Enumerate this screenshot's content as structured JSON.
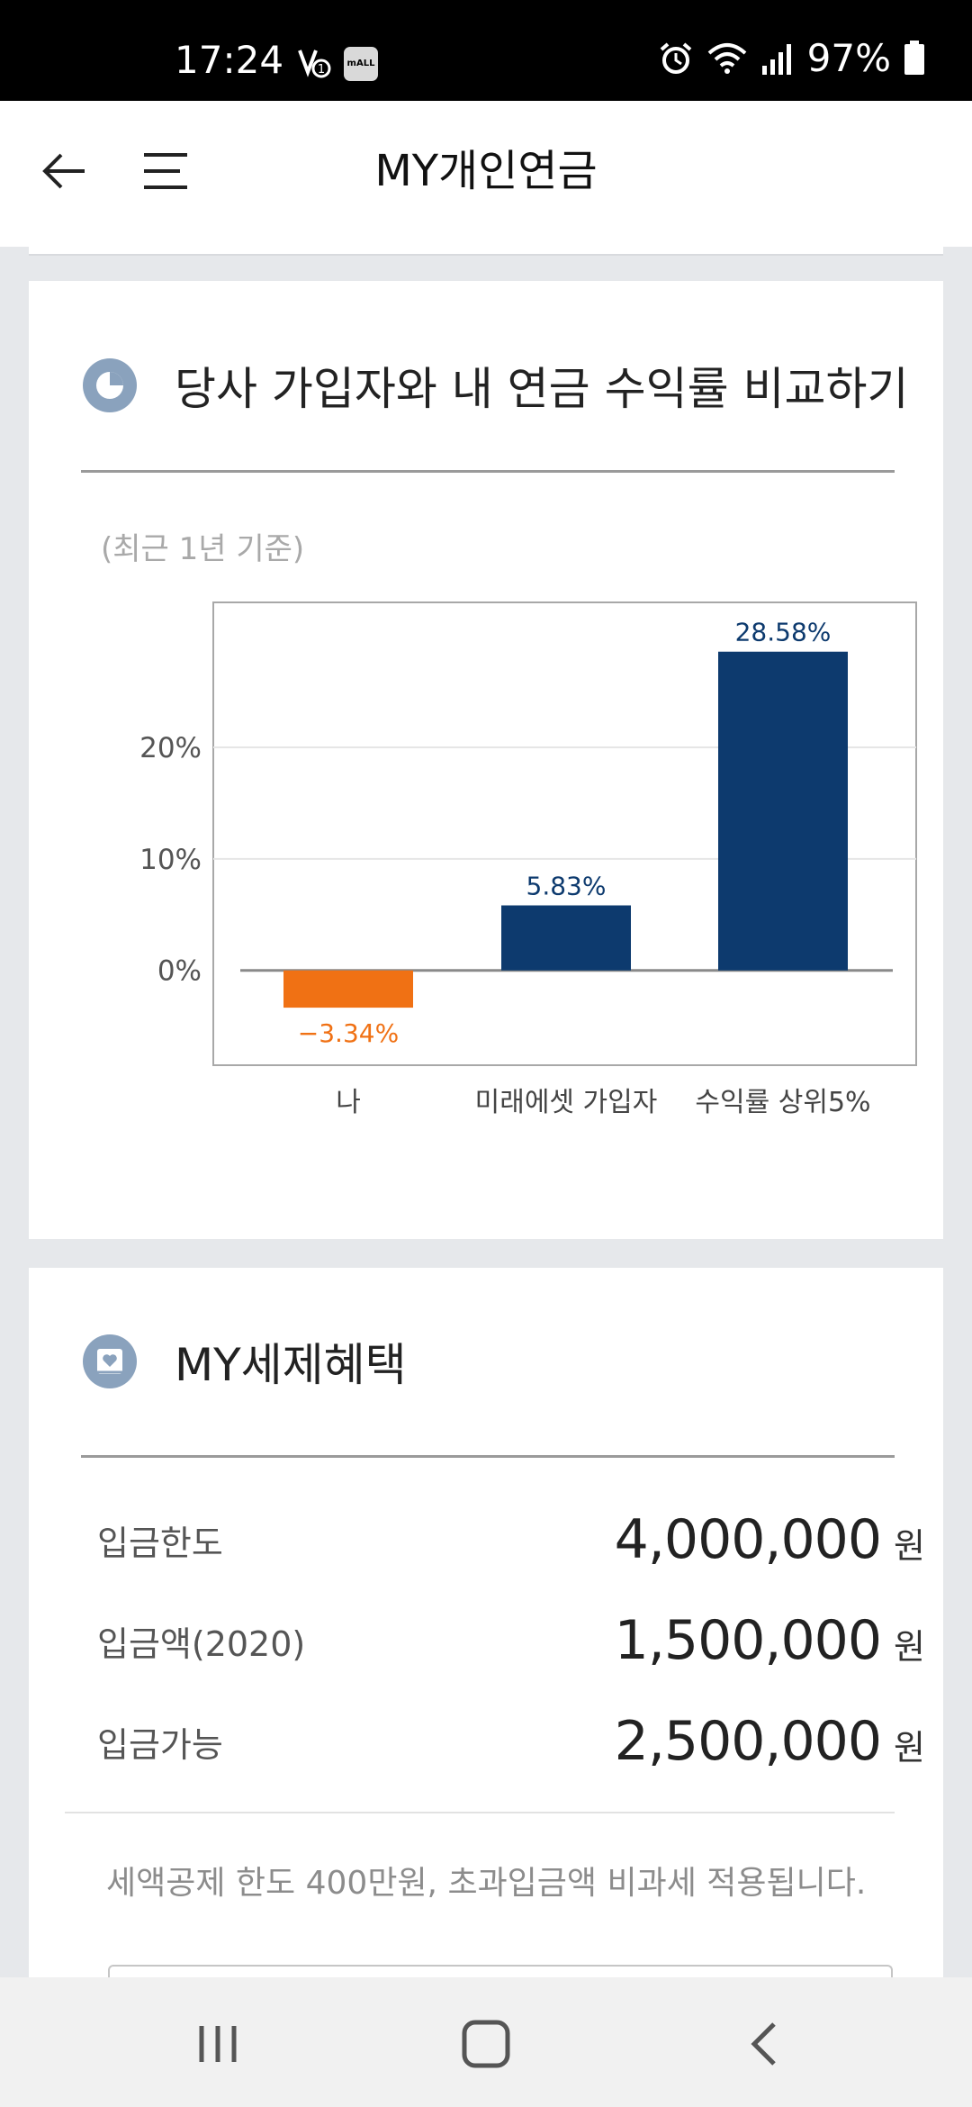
{
  "status_bar": {
    "time": "17:24",
    "mall_badge": "mALL",
    "battery": "97%"
  },
  "app_bar": {
    "title": "MY개인연금"
  },
  "return_card": {
    "title": "당사 가입자와 내 연금 수익률 비교하기",
    "basis": "(최근 1년 기준)"
  },
  "chart_data": {
    "type": "bar",
    "categories": [
      "나",
      "미래에셋 가입자",
      "수익률 상위5%"
    ],
    "values": [
      -3.34,
      5.83,
      28.58
    ],
    "value_labels": [
      "−3.34%",
      "5.83%",
      "28.58%"
    ],
    "y_ticks": [
      "0%",
      "10%",
      "20%"
    ],
    "y_tick_values": [
      0,
      10,
      20
    ],
    "ylim": [
      -8.5,
      33
    ],
    "bar_colors": [
      "#f07114",
      "#0d3a6e",
      "#0d3a6e"
    ],
    "grid": true,
    "title": "",
    "xlabel": "",
    "ylabel": ""
  },
  "tax_card": {
    "title": "MY세제혜택",
    "rows": [
      {
        "label": "입금한도",
        "value": "4,000,000",
        "unit": "원"
      },
      {
        "label": "입금액(2020)",
        "value": "1,500,000",
        "unit": "원"
      },
      {
        "label": "입금가능",
        "value": "2,500,000",
        "unit": "원"
      }
    ],
    "note": "세액공제 한도 400만원, 초과입금액 비과세 적용됩니다."
  },
  "colors": {
    "accent_navy": "#0d3a6e",
    "accent_orange": "#f07114",
    "icon_bg": "#8aa2bd"
  }
}
